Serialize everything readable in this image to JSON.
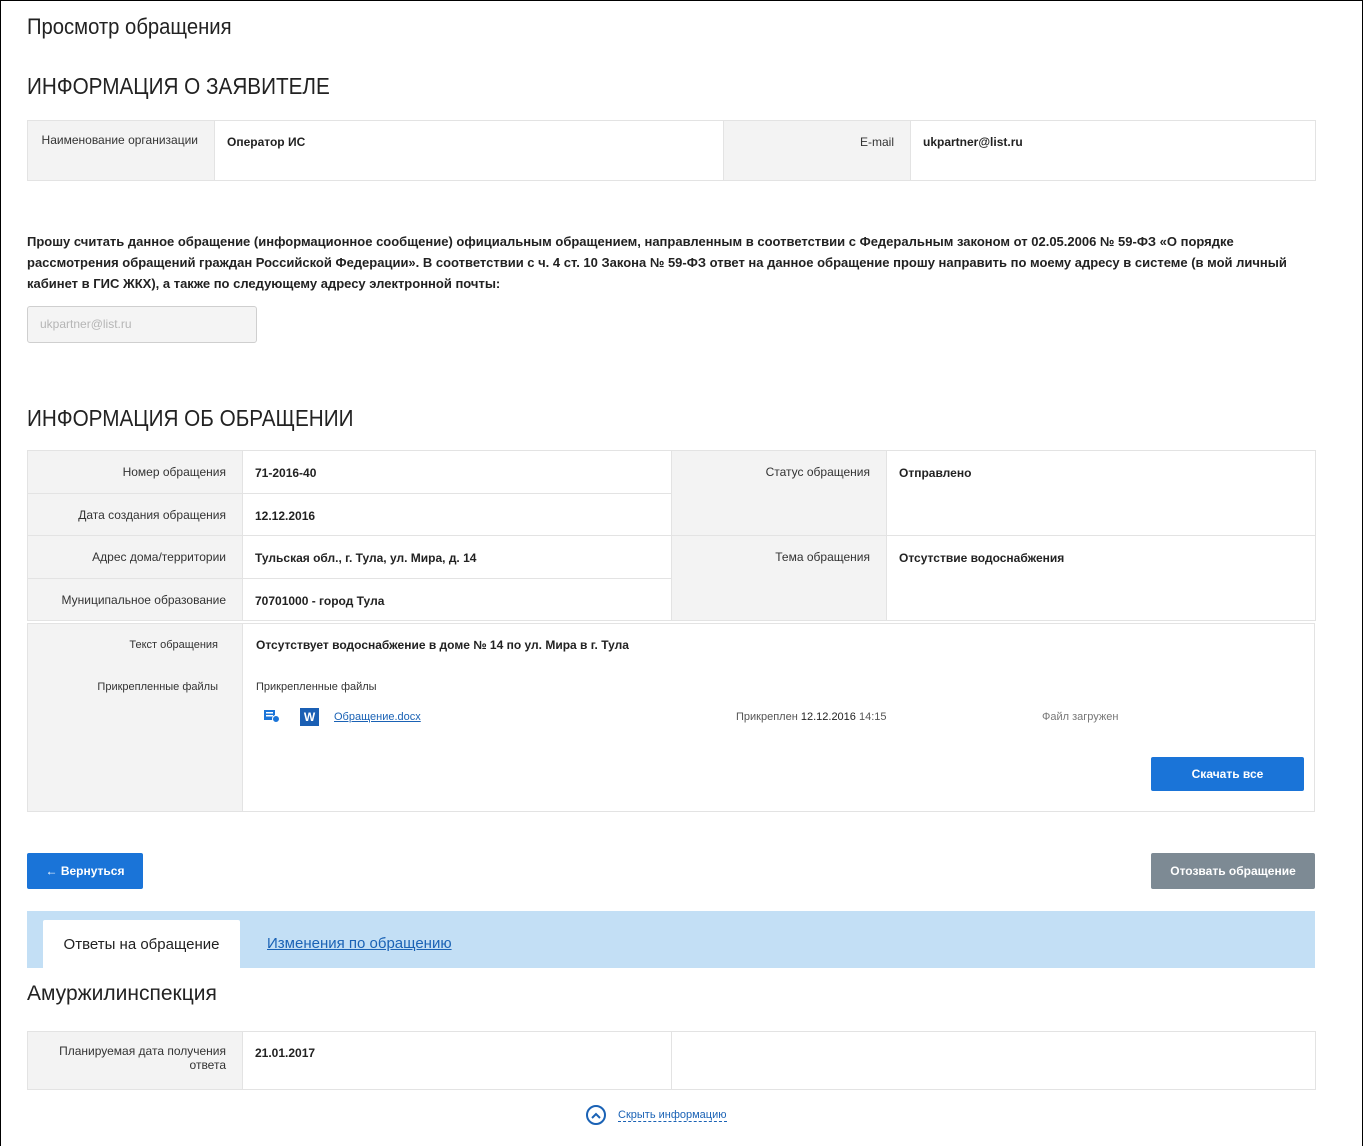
{
  "page_title": "Просмотр обращения",
  "applicant_section": {
    "title": "ИНФОРМАЦИЯ О ЗАЯВИТЕЛЕ",
    "org_label": "Наименование организации",
    "org_value": "Оператор ИС",
    "email_label": "E-mail",
    "email_value": "ukpartner@list.ru"
  },
  "notice_text": "Прошу считать данное обращение (информационное сообщение) официальным обращением, направленным в соответствии с Федеральным законом от 02.05.2006 № 59-ФЗ «О порядке рассмотрения обращений граждан Российской Федерации». В соответствии с ч. 4 ст. 10 Закона № 59-ФЗ ответ на данное обращение прошу направить по моему адресу в системе (в мой личный кабинет в ГИС ЖКХ), а также по следующему адресу электронной почты:",
  "email_input_value": "ukpartner@list.ru",
  "request_section": {
    "title": "ИНФОРМАЦИЯ ОБ ОБРАЩЕНИИ",
    "number_label": "Номер обращения",
    "number_value": "71-2016-40",
    "status_label": "Статус обращения",
    "status_value": "Отправлено",
    "created_label": "Дата создания обращения",
    "created_value": "12.12.2016",
    "address_label": "Адрес дома/территории",
    "address_value": "Тульская обл., г. Тула, ул. Мира, д. 14",
    "topic_label": "Тема обращения",
    "topic_value": "Отсутствие водоснабжения",
    "municipality_label": "Муниципальное образование",
    "municipality_value": "70701000 - город Тула",
    "text_label": "Текст обращения",
    "text_value": "Отсутствует водоснабжение в доме № 14 по ул. Мира в г. Тула",
    "files_label": "Прикрепленные файлы",
    "files_header": "Прикрепленные файлы",
    "file": {
      "name": "Обращение.docx",
      "attached_prefix": "Прикреплен",
      "attached_date": "12.12.2016",
      "attached_time": "14:15",
      "status": "Файл загружен",
      "type_badge": "W"
    },
    "download_all": "Скачать все"
  },
  "buttons": {
    "back": "← Вернуться",
    "withdraw": "Отозвать обращение"
  },
  "tabs": {
    "active": "Ответы на обращение",
    "other": "Изменения по обращению"
  },
  "response": {
    "org_name": "Амуржилинспекция",
    "planned_label": "Планируемая дата получения ответа",
    "planned_value": "21.01.2017"
  },
  "hide_link": "Скрыть информацию",
  "colors": {
    "primary_button": "#1a74d8",
    "secondary_button": "#7d8a94",
    "tabs_bar": "#c3dff5",
    "label_bg": "#f3f3f3",
    "link": "#1a62b5"
  }
}
